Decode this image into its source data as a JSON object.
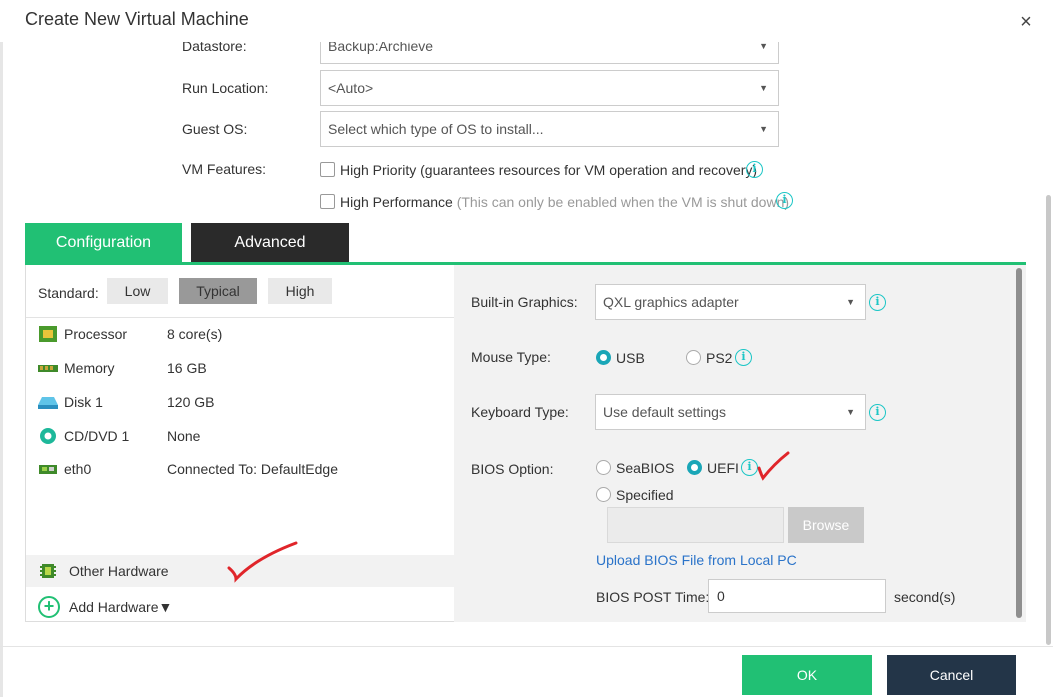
{
  "dialog": {
    "title": "Create New Virtual Machine",
    "close_glyph": "×"
  },
  "general": {
    "datastore_label": "Datastore:",
    "datastore_value": "Backup:Archieve",
    "run_location_label": "Run Location:",
    "run_location_value": "<Auto>",
    "guest_os_label": "Guest OS:",
    "guest_os_placeholder": "Select which type of OS to install...",
    "vm_features_label": "VM Features:",
    "high_priority_label": "High Priority (guarantees resources for VM operation and recovery)",
    "high_performance_label": "High Performance",
    "high_performance_note": "(This can only be enabled when the VM is shut down)"
  },
  "tabs": {
    "configuration": "Configuration",
    "advanced": "Advanced"
  },
  "standard": {
    "label": "Standard:",
    "low": "Low",
    "typical": "Typical",
    "high": "High"
  },
  "hardware": [
    {
      "name": "Processor",
      "value": "8 core(s)",
      "icon": "processor-icon"
    },
    {
      "name": "Memory",
      "value": "16 GB",
      "icon": "memory-icon"
    },
    {
      "name": "Disk 1",
      "value": "120 GB",
      "icon": "disk-icon"
    },
    {
      "name": "CD/DVD 1",
      "value": "None",
      "icon": "cd-dvd-icon"
    },
    {
      "name": "eth0",
      "value": "Connected To: DefaultEdge",
      "icon": "network-icon"
    }
  ],
  "other_hardware": "Other Hardware",
  "add_hardware": "Add Hardware▼",
  "advanced_panel": {
    "graphics_label": "Built-in Graphics:",
    "graphics_value": "QXL graphics adapter",
    "mouse_label": "Mouse Type:",
    "mouse_usb": "USB",
    "mouse_ps2": "PS2",
    "mouse_selected": "USB",
    "keyboard_label": "Keyboard Type:",
    "keyboard_value": "Use default settings",
    "bios_label": "BIOS Option:",
    "bios_seabios": "SeaBIOS",
    "bios_uefi": "UEFI",
    "bios_specified": "Specified",
    "bios_selected": "UEFI",
    "browse": "Browse",
    "upload_link": "Upload BIOS File from Local PC",
    "post_time_label": "BIOS POST Time:",
    "post_time_value": "0",
    "post_time_unit": "second(s)"
  },
  "footer": {
    "ok": "OK",
    "cancel": "Cancel"
  },
  "colors": {
    "accent": "#21c074",
    "dark_tab": "#2a2a2a",
    "cancel_bg": "#233548",
    "info": "#1cc6c6",
    "radio_on": "#1aa6b7",
    "link": "#2a73c9",
    "annotation": "#e0252a"
  }
}
